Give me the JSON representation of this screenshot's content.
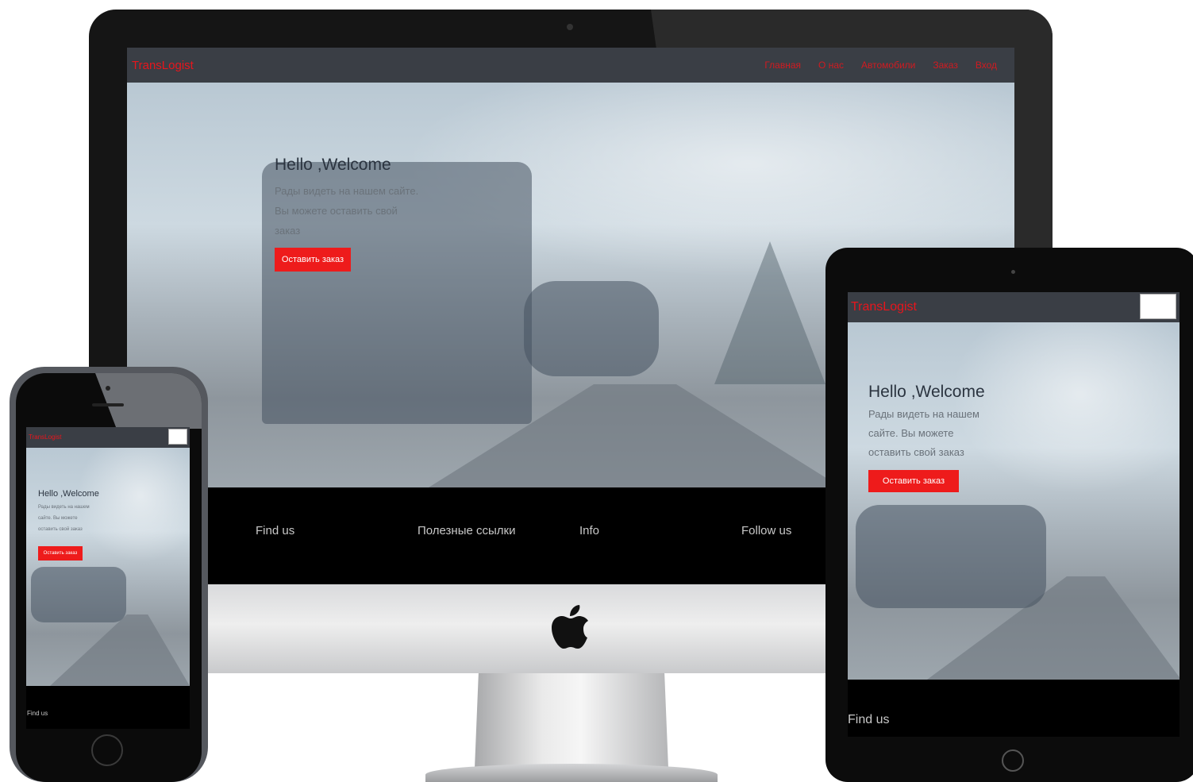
{
  "site": {
    "brand": "TransLogist",
    "nav_links": [
      "Главная",
      "О нас",
      "Автомобили",
      "Заказ",
      "Вход"
    ],
    "hero_title": "Hello ,Welcome",
    "hero_text_desktop": [
      "Рады видеть на нашем сайте.",
      "Вы можете оставить свой",
      "заказ"
    ],
    "hero_text_tablet": [
      "Рады видеть на нашем",
      "сайте. Вы можете",
      "оставить свой заказ"
    ],
    "hero_text_phone": [
      "Рады видеть на нашем",
      "сайте. Вы можете",
      "оставить свой заказ"
    ],
    "cta_label": "Оставить заказ",
    "footer_links": [
      "Find us",
      "Полезные ссылки",
      "Info",
      "Follow us"
    ]
  },
  "colors": {
    "accent": "#ee1b1b",
    "navbar": "#3a3e45",
    "footer": "#000000"
  },
  "icons": {
    "apple_logo": "apple-logo-icon",
    "menu_toggle": "hamburger-toggle-icon"
  }
}
